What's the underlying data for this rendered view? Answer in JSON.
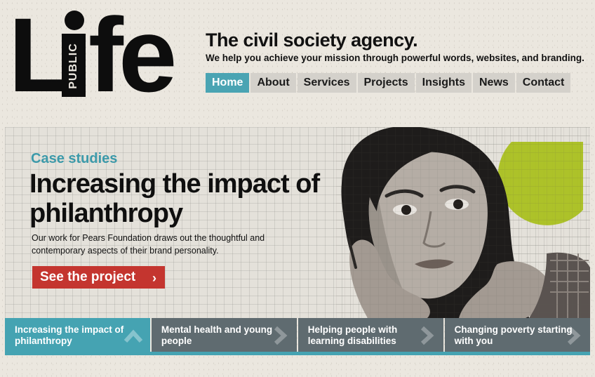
{
  "logo": {
    "big_text_left": "Li",
    "big_text_right": "fe",
    "vertical_text": "PUBLIC"
  },
  "header": {
    "title": "The civil society agency.",
    "subtitle": "We help you achieve your mission through powerful words, websites, and branding."
  },
  "nav": {
    "items": [
      {
        "label": "Home",
        "active": true
      },
      {
        "label": "About"
      },
      {
        "label": "Services"
      },
      {
        "label": "Projects"
      },
      {
        "label": "Insights"
      },
      {
        "label": "News"
      },
      {
        "label": "Contact"
      }
    ]
  },
  "hero": {
    "eyebrow": "Case studies",
    "title": "Increasing the impact of philanthropy",
    "description": "Our work for Pears Foundation draws out the thoughtful and contemporary aspects of their brand personality.",
    "cta_label": "See the project",
    "cta_icon": "chevron-right-icon"
  },
  "tabs": [
    {
      "label": "Increasing the impact of philanthropy",
      "active": true,
      "icon": "chevron-up-icon"
    },
    {
      "label": "Mental health and young people",
      "icon": "chevron-right-icon"
    },
    {
      "label": "Helping people with learning disabilities",
      "icon": "chevron-right-icon"
    },
    {
      "label": "Changing poverty starting with you",
      "icon": "chevron-right-icon"
    }
  ],
  "colors": {
    "accent_teal": "#45a3b2",
    "cta_red": "#c4352f",
    "tab_gray": "#5f6b70",
    "circle_green": "#a8bf1a",
    "background": "#ebe7df"
  }
}
